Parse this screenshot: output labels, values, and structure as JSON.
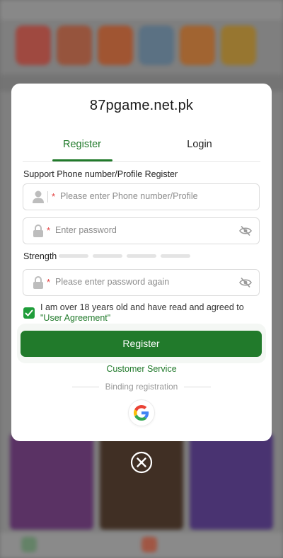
{
  "modal": {
    "site_title": "87pgame.net.pk",
    "tabs": [
      {
        "label": "Register",
        "active": true
      },
      {
        "label": "Login",
        "active": false
      }
    ],
    "section_label": "Support Phone number/Profile Register",
    "phone_field": {
      "required_mark": "*",
      "placeholder": "Please enter Phone number/Profile",
      "icon": "user-icon"
    },
    "password_field": {
      "required_mark": "*",
      "placeholder": "Enter password",
      "icon": "lock-icon",
      "toggle_icon": "eye-off-icon"
    },
    "strength": {
      "label": "Strength",
      "segments": 4,
      "filled": 0
    },
    "confirm_field": {
      "required_mark": "*",
      "placeholder": "Please enter password again",
      "icon": "lock-icon",
      "toggle_icon": "eye-off-icon"
    },
    "agreement": {
      "checked": true,
      "text": "I am over 18 years old and have read and agreed to ",
      "link": "\"User Agreement\""
    },
    "register_button": "Register",
    "customer_service": "Customer Service",
    "binding_label": "Binding registration",
    "google_icon": "google-icon"
  },
  "close_icon": "close-circle-icon",
  "colors": {
    "accent": "#217a2b",
    "checkbox": "#1f9d3a",
    "required": "#e23b3b",
    "overlay": "#8a8a8a"
  }
}
